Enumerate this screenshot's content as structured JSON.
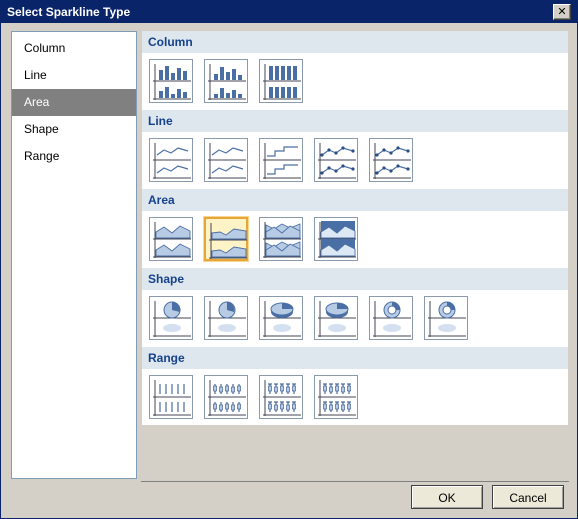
{
  "window": {
    "title": "Select Sparkline Type",
    "close_label": "✕"
  },
  "sidebar": {
    "items": [
      {
        "label": "Column",
        "selected": false
      },
      {
        "label": "Line",
        "selected": false
      },
      {
        "label": "Area",
        "selected": true
      },
      {
        "label": "Shape",
        "selected": false
      },
      {
        "label": "Range",
        "selected": false
      }
    ]
  },
  "gallery": {
    "sections": [
      {
        "title": "Column",
        "count": 3,
        "icon": "column-chart-icon"
      },
      {
        "title": "Line",
        "count": 5,
        "icon": "line-chart-icon"
      },
      {
        "title": "Area",
        "count": 4,
        "icon": "area-chart-icon",
        "selected_index": 1
      },
      {
        "title": "Shape",
        "count": 6,
        "icon": "pie-chart-icon"
      },
      {
        "title": "Range",
        "count": 4,
        "icon": "range-chart-icon"
      }
    ]
  },
  "buttons": {
    "ok_label": "OK",
    "cancel_label": "Cancel"
  },
  "colors": {
    "selection": "#e8a53a",
    "section_header": "#dee7ee",
    "header_text": "#15428b",
    "list_selected": "#808080"
  }
}
